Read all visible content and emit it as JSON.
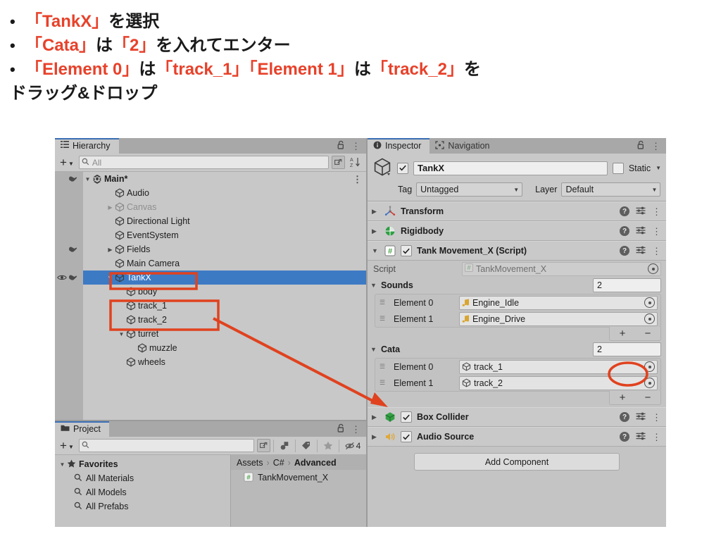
{
  "instructions": [
    {
      "bullet": "•",
      "parts": [
        {
          "t": "「TankX」",
          "hl": true
        },
        {
          "t": "を選択",
          "hl": false
        }
      ]
    },
    {
      "bullet": "•",
      "parts": [
        {
          "t": "「Cata」",
          "hl": true
        },
        {
          "t": "は",
          "hl": false
        },
        {
          "t": "「2」",
          "hl": true
        },
        {
          "t": "を入れてエンター",
          "hl": false
        }
      ]
    },
    {
      "bullet": "•",
      "parts": [
        {
          "t": "「Element 0」",
          "hl": true
        },
        {
          "t": "は",
          "hl": false
        },
        {
          "t": "「track_1」",
          "hl": true
        },
        {
          "t": "「Element 1」",
          "hl": true
        },
        {
          "t": "は",
          "hl": false
        },
        {
          "t": "「track_2」",
          "hl": true
        },
        {
          "t": "を",
          "hl": false
        }
      ]
    },
    {
      "bullet": "",
      "parts": [
        {
          "t": "ドラッグ&ドロップ",
          "hl": false
        }
      ]
    }
  ],
  "colors": {
    "annotation_red": "#e0421f",
    "highlight_red": "#e8412a",
    "selection_blue": "#3d7ac4",
    "tab_accent_blue": "#3a6fb5"
  },
  "hierarchy": {
    "tab_label": "Hierarchy",
    "toolbar": {
      "add_label": "+",
      "search_placeholder": "All",
      "search_value": "",
      "sort_label": "A\nZ"
    },
    "rows": [
      {
        "label": "Main*",
        "indent": 0,
        "arrow": "down",
        "bold": true,
        "dim": false,
        "selected": false,
        "scene": true,
        "kebab": true
      },
      {
        "label": "Audio",
        "indent": 2,
        "arrow": "none",
        "bold": false,
        "dim": false,
        "selected": false,
        "scene": false,
        "kebab": false
      },
      {
        "label": "Canvas",
        "indent": 2,
        "arrow": "right",
        "bold": false,
        "dim": true,
        "selected": false,
        "scene": false,
        "kebab": false
      },
      {
        "label": "Directional Light",
        "indent": 2,
        "arrow": "none",
        "bold": false,
        "dim": false,
        "selected": false,
        "scene": false,
        "kebab": false
      },
      {
        "label": "EventSystem",
        "indent": 2,
        "arrow": "none",
        "bold": false,
        "dim": false,
        "selected": false,
        "scene": false,
        "kebab": false
      },
      {
        "label": "Fields",
        "indent": 2,
        "arrow": "right",
        "bold": false,
        "dim": false,
        "selected": false,
        "scene": false,
        "kebab": false
      },
      {
        "label": "Main Camera",
        "indent": 2,
        "arrow": "none",
        "bold": false,
        "dim": false,
        "selected": false,
        "scene": false,
        "kebab": false
      },
      {
        "label": "TankX",
        "indent": 2,
        "arrow": "down",
        "bold": false,
        "dim": false,
        "selected": true,
        "scene": false,
        "kebab": false
      },
      {
        "label": "body",
        "indent": 3,
        "arrow": "none",
        "bold": false,
        "dim": false,
        "selected": false,
        "scene": false,
        "kebab": false
      },
      {
        "label": "track_1",
        "indent": 3,
        "arrow": "none",
        "bold": false,
        "dim": false,
        "selected": false,
        "scene": false,
        "kebab": false
      },
      {
        "label": "track_2",
        "indent": 3,
        "arrow": "none",
        "bold": false,
        "dim": false,
        "selected": false,
        "scene": false,
        "kebab": false
      },
      {
        "label": "turret",
        "indent": 3,
        "arrow": "down",
        "bold": false,
        "dim": false,
        "selected": false,
        "scene": false,
        "kebab": false
      },
      {
        "label": "muzzle",
        "indent": 4,
        "arrow": "none",
        "bold": false,
        "dim": false,
        "selected": false,
        "scene": false,
        "kebab": false
      },
      {
        "label": "wheels",
        "indent": 3,
        "arrow": "none",
        "bold": false,
        "dim": false,
        "selected": false,
        "scene": false,
        "kebab": false
      }
    ]
  },
  "project": {
    "tab_label": "Project",
    "toolbar": {
      "add_label": "+",
      "search_placeholder": "",
      "hidden_count": "4"
    },
    "favorites": {
      "title": "Favorites",
      "items": [
        "All Materials",
        "All Models",
        "All Prefabs"
      ]
    },
    "breadcrumb": [
      "Assets",
      "C#",
      "Advanced"
    ],
    "assets": [
      {
        "name": "TankMovement_X",
        "icon": "csharp-script-icon"
      }
    ]
  },
  "inspector": {
    "tabs": [
      {
        "label": "Inspector",
        "icon": "info-icon",
        "active": true
      },
      {
        "label": "Navigation",
        "icon": "navigation-icon",
        "active": false
      }
    ],
    "object": {
      "enabled": true,
      "name": "TankX",
      "static_label": "Static",
      "static_checked": false,
      "tag_label": "Tag",
      "tag_value": "Untagged",
      "layer_label": "Layer",
      "layer_value": "Default"
    },
    "components": [
      {
        "name": "Transform",
        "icon": "transform-icon",
        "expanded": false,
        "has_checkbox": false,
        "checked": false
      },
      {
        "name": "Rigidbody",
        "icon": "rigidbody-icon",
        "expanded": false,
        "has_checkbox": false,
        "checked": false
      },
      {
        "name": "Tank Movement_X (Script)",
        "icon": "script-icon",
        "expanded": true,
        "has_checkbox": true,
        "checked": true
      }
    ],
    "script_body": {
      "script_label": "Script",
      "script_value": "TankMovement_X",
      "arrays": [
        {
          "name": "Sounds",
          "size": "2",
          "expanded": true,
          "elements": [
            {
              "label": "Element 0",
              "value": "Engine_Idle",
              "icon": "audio-clip-icon"
            },
            {
              "label": "Element 1",
              "value": "Engine_Drive",
              "icon": "audio-clip-icon"
            }
          ],
          "add_label": "+",
          "remove_label": "−"
        },
        {
          "name": "Cata",
          "size": "2",
          "expanded": true,
          "elements": [
            {
              "label": "Element 0",
              "value": "track_1",
              "icon": "gameobject-icon"
            },
            {
              "label": "Element 1",
              "value": "track_2",
              "icon": "gameobject-icon"
            }
          ],
          "add_label": "+",
          "remove_label": "−"
        }
      ]
    },
    "components_bottom": [
      {
        "name": "Box Collider",
        "icon": "box-collider-icon",
        "expanded": false,
        "has_checkbox": true,
        "checked": true
      },
      {
        "name": "Audio Source",
        "icon": "audio-source-icon",
        "expanded": false,
        "has_checkbox": true,
        "checked": true
      }
    ],
    "add_component_label": "Add Component"
  }
}
